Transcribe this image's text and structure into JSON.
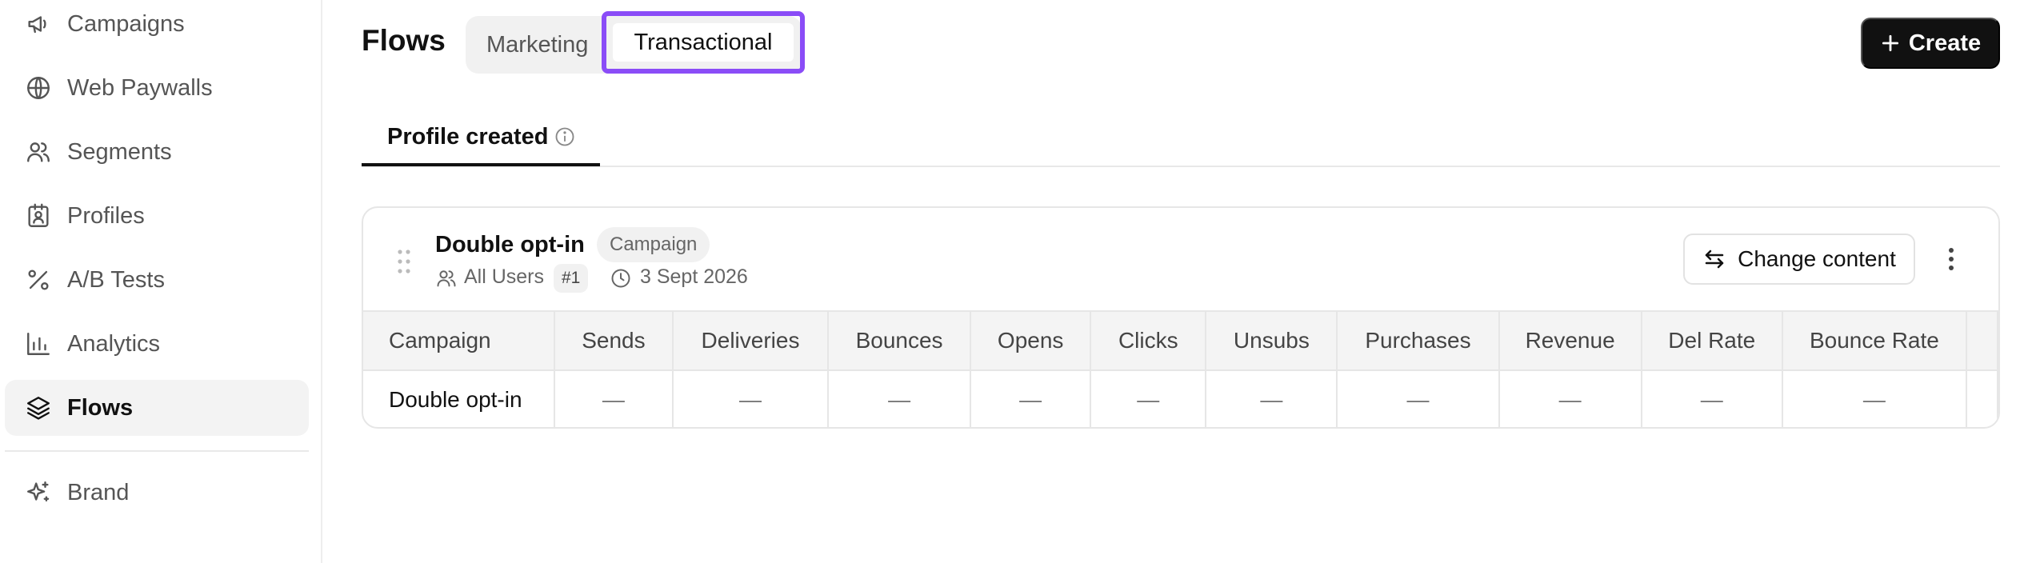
{
  "sidebar": {
    "items": [
      {
        "label": "Campaigns",
        "icon": "megaphone-icon",
        "active": false
      },
      {
        "label": "Web Paywalls",
        "icon": "globe-icon",
        "active": false
      },
      {
        "label": "Segments",
        "icon": "users-icon",
        "active": false
      },
      {
        "label": "Profiles",
        "icon": "contact-card-icon",
        "active": false
      },
      {
        "label": "A/B Tests",
        "icon": "percent-icon",
        "active": false
      },
      {
        "label": "Analytics",
        "icon": "bar-chart-icon",
        "active": false
      },
      {
        "label": "Flows",
        "icon": "layers-icon",
        "active": true
      },
      {
        "label": "Brand",
        "icon": "sparkles-icon",
        "active": false
      }
    ]
  },
  "header": {
    "title": "Flows",
    "tabs": [
      {
        "label": "Marketing",
        "selected": false
      },
      {
        "label": "Transactional",
        "selected": true
      }
    ],
    "create_label": "Create",
    "highlight_color": "#8a4cf7"
  },
  "trigger_tabs": [
    {
      "label": "Profile created",
      "selected": true
    }
  ],
  "flow_card": {
    "title": "Double opt-in",
    "badge": "Campaign",
    "audience": "All Users",
    "audience_count": "#1",
    "date": "3 Sept 2026",
    "change_content_label": "Change content"
  },
  "table": {
    "columns": [
      "Campaign",
      "Sends",
      "Deliveries",
      "Bounces",
      "Opens",
      "Clicks",
      "Unsubs",
      "Purchases",
      "Revenue",
      "Del Rate",
      "Bounce Rate"
    ],
    "rows": [
      [
        "Double opt-in",
        "—",
        "—",
        "—",
        "—",
        "—",
        "—",
        "—",
        "—",
        "—",
        "—"
      ]
    ]
  }
}
